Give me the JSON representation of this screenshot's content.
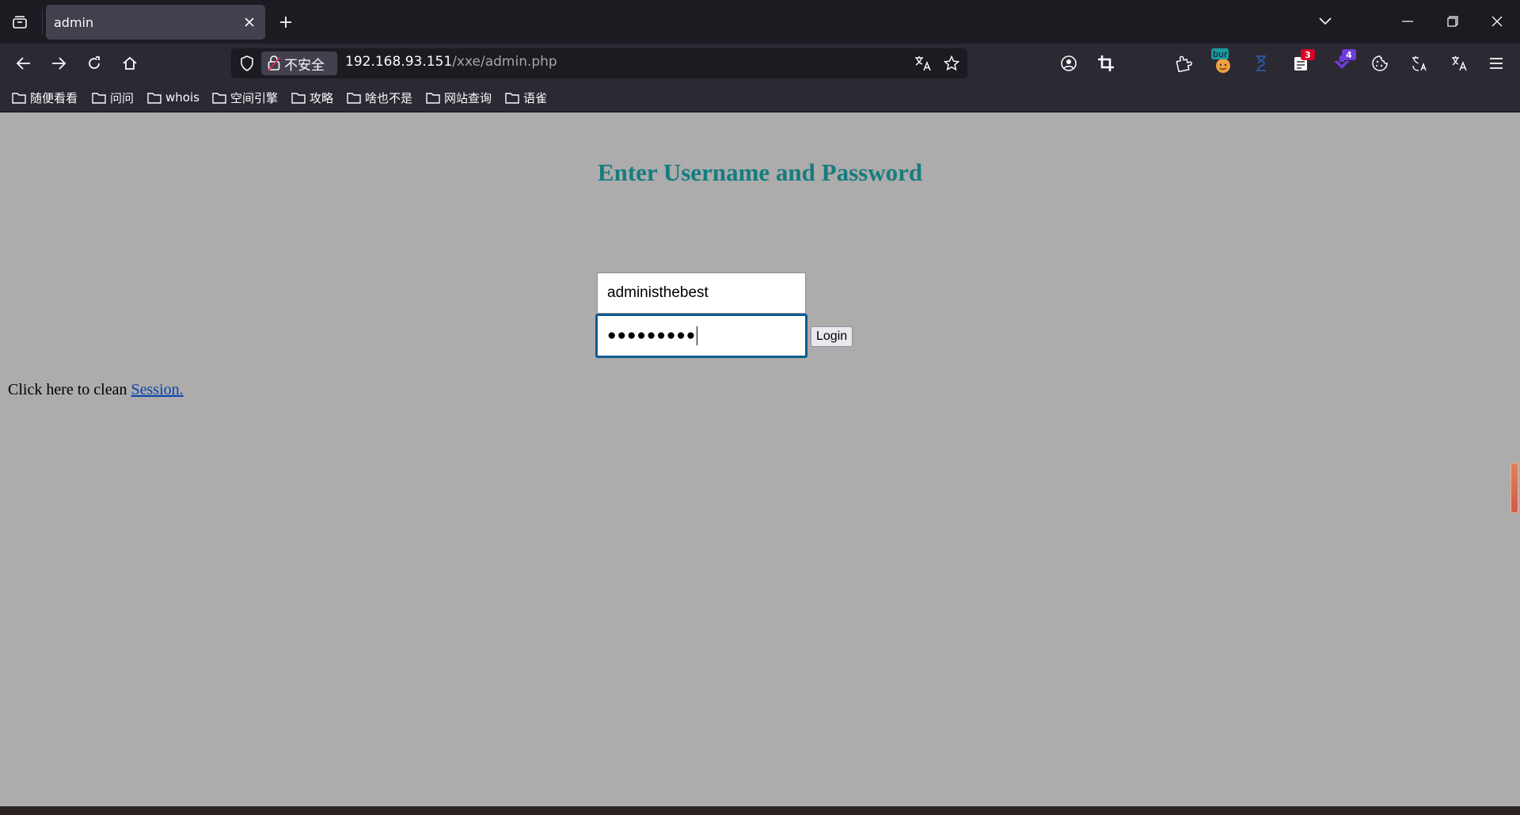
{
  "tab": {
    "title": "admin"
  },
  "urlbar": {
    "security_label": "不安全",
    "host": "192.168.93.151",
    "path": "/xxe/admin.php"
  },
  "extensions": {
    "burp_label": "bur",
    "badge_a": "3",
    "badge_b": "4"
  },
  "bookmarks": [
    "随便看看",
    "问问",
    "whois",
    "空间引擎",
    "攻略",
    "啥也不是",
    "网站查询",
    "语雀"
  ],
  "page": {
    "heading": "Enter Username and Password",
    "username_value": "administhebest",
    "password_mask": "●●●●●●●●●",
    "login_label": "Login",
    "session_prefix": "Click here to clean ",
    "session_link": "Session."
  },
  "colors": {
    "page_bg": "#adabac",
    "heading": "#167d7f",
    "focus_ring": "#0b5d8f",
    "chrome_dark": "#1c1b22",
    "chrome_mid": "#2b2a33"
  }
}
